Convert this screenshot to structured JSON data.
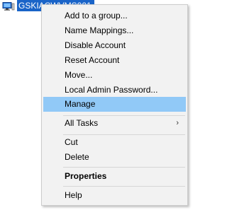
{
  "tree_node": {
    "label": "GSKIACWVMS001",
    "icon": "computer-icon"
  },
  "context_menu": {
    "items": [
      {
        "label": "Add to a group..."
      },
      {
        "label": "Name Mappings..."
      },
      {
        "label": "Disable Account"
      },
      {
        "label": "Reset Account"
      },
      {
        "label": "Move..."
      },
      {
        "label": "Local Admin Password..."
      },
      {
        "label": "Manage",
        "highlighted": true
      },
      {
        "label": "All Tasks",
        "submenu_arrow": "›"
      },
      {
        "label": "Cut"
      },
      {
        "label": "Delete"
      },
      {
        "label": "Properties",
        "bold": true
      },
      {
        "label": "Help"
      }
    ]
  },
  "colors": {
    "selection_bg": "#1a64c8",
    "highlight_bg": "#91c9f7",
    "menu_bg": "#f2f2f2"
  }
}
